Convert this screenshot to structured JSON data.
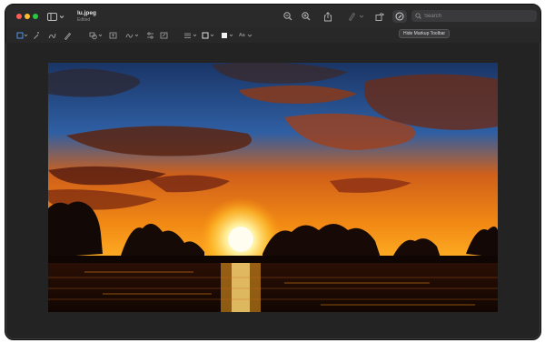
{
  "window": {
    "title": "lu.jpeg",
    "subtitle": "Edited"
  },
  "toolbar": {
    "search_placeholder": "Search",
    "tooltip": "Hide Markup Toolbar"
  },
  "markup": {
    "text_style_label": "Aa"
  },
  "icons": {
    "close": "close-window-icon",
    "minimize": "minimize-window-icon",
    "maximize": "maximize-window-icon",
    "sidebar": "sidebar-icon",
    "zoom_out": "zoom-out-icon",
    "zoom_in": "zoom-in-icon",
    "share": "share-icon",
    "highlight": "highlighter-icon",
    "rotate": "rotate-icon",
    "markup": "markup-icon",
    "search": "search-icon"
  },
  "image": {
    "subject": "sunset over water with silhouetted trees"
  }
}
